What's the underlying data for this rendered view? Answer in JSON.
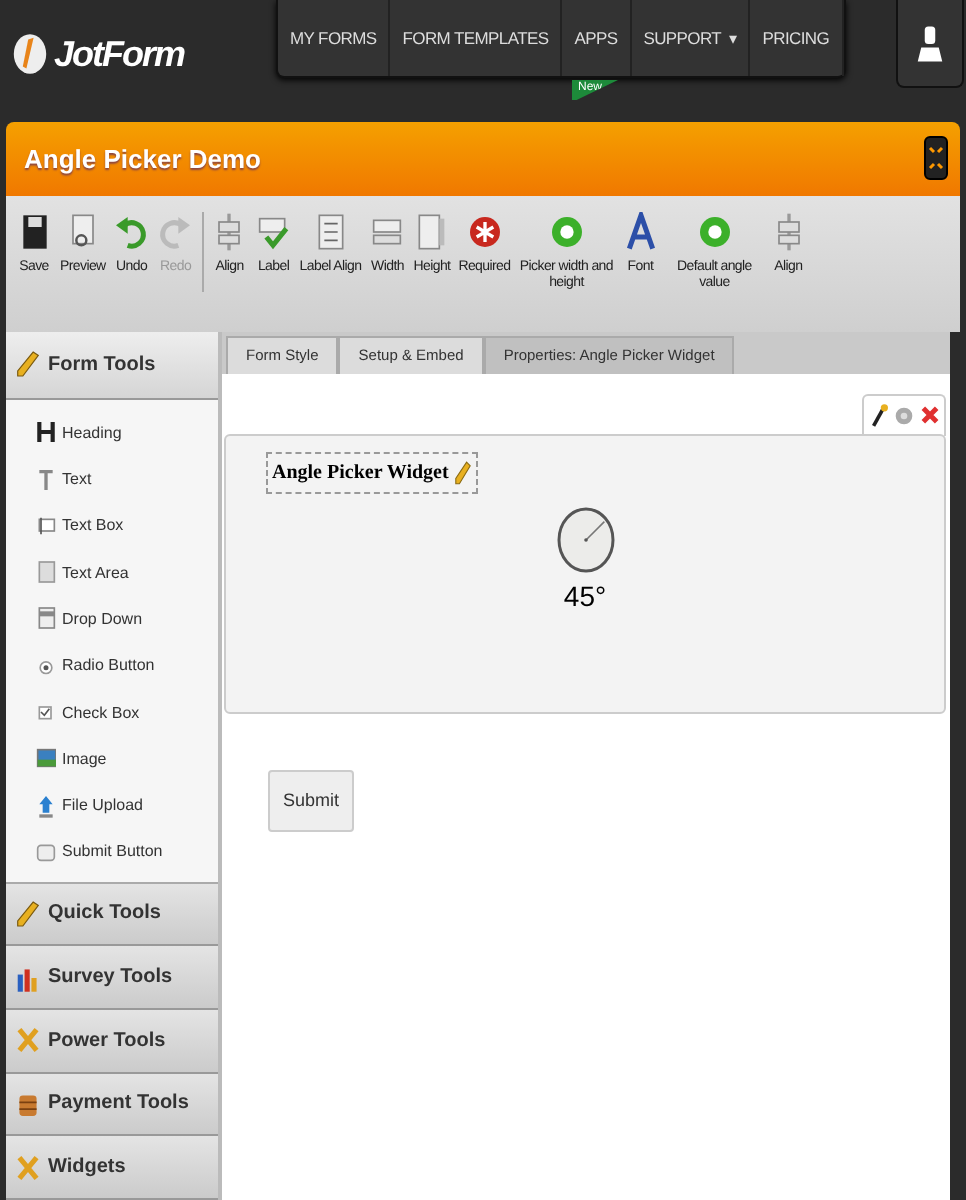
{
  "logo": {
    "text": "JotForm"
  },
  "nav": [
    {
      "label": "MY FORMS",
      "dropdown": false
    },
    {
      "label": "FORM TEMPLATES",
      "dropdown": false
    },
    {
      "label": "APPS",
      "dropdown": false
    },
    {
      "label": "SUPPORT",
      "dropdown": true,
      "caret": "▾"
    },
    {
      "label": "PRICING",
      "dropdown": false
    }
  ],
  "new_badge": "New",
  "title_bar": {
    "title": "Angle Picker Demo"
  },
  "toolbar": [
    {
      "label": "Save",
      "kind": "save",
      "disabled": false
    },
    {
      "label": "Preview",
      "kind": "preview",
      "disabled": false
    },
    {
      "label": "Undo",
      "kind": "undo",
      "disabled": false
    },
    {
      "label": "Redo",
      "kind": "redo",
      "disabled": true
    },
    {
      "label": "Align",
      "kind": "align",
      "disabled": false,
      "separator": true
    },
    {
      "label": "Label",
      "kind": "label",
      "disabled": false
    },
    {
      "label": "Label Align",
      "kind": "labelalign",
      "disabled": false
    },
    {
      "label": "Width",
      "kind": "width",
      "disabled": false
    },
    {
      "label": "Height",
      "kind": "height",
      "disabled": false
    },
    {
      "label": "Required",
      "kind": "required",
      "disabled": false
    },
    {
      "label": "Picker width and height",
      "kind": "greendot",
      "disabled": false
    },
    {
      "label": "Font",
      "kind": "font",
      "disabled": false
    },
    {
      "label": "Default angle value",
      "kind": "greendot",
      "disabled": false
    },
    {
      "label": "Align",
      "kind": "align",
      "disabled": false
    }
  ],
  "sidebar": {
    "sections": [
      {
        "label": "Form Tools",
        "kind": "pencil",
        "expanded": true,
        "items": [
          {
            "label": "Heading",
            "kind": "heading"
          },
          {
            "label": "Text",
            "kind": "text"
          },
          {
            "label": "Text Box",
            "kind": "textbox"
          },
          {
            "label": "Text Area",
            "kind": "textarea"
          },
          {
            "label": "Drop Down",
            "kind": "dropdown"
          },
          {
            "label": "Radio Button",
            "kind": "radio"
          },
          {
            "label": "Check Box",
            "kind": "check"
          },
          {
            "label": "Image",
            "kind": "image"
          },
          {
            "label": "File Upload",
            "kind": "upload"
          },
          {
            "label": "Submit Button",
            "kind": "submit"
          }
        ]
      },
      {
        "label": "Quick Tools",
        "kind": "pencil",
        "expanded": false
      },
      {
        "label": "Survey Tools",
        "kind": "chart",
        "expanded": false
      },
      {
        "label": "Power Tools",
        "kind": "tools",
        "expanded": false
      },
      {
        "label": "Payment Tools",
        "kind": "coins",
        "expanded": false
      },
      {
        "label": "Widgets",
        "kind": "tools",
        "expanded": false
      }
    ]
  },
  "tabs": [
    {
      "label": "Form Style",
      "selected": false
    },
    {
      "label": "Setup & Embed",
      "selected": false
    },
    {
      "label": "Properties: Angle Picker Widget",
      "selected": true
    }
  ],
  "widget": {
    "label": "Angle Picker Widget",
    "reading": "45°"
  },
  "submit_button": "Submit"
}
